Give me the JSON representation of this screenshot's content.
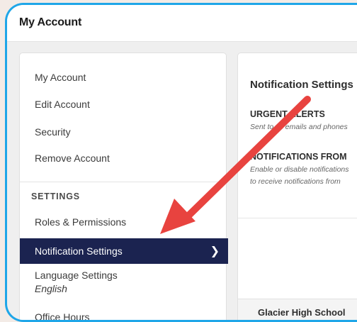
{
  "window": {
    "title": "My Account"
  },
  "sidebar": {
    "items": [
      {
        "label": "My Account"
      },
      {
        "label": "Edit Account"
      },
      {
        "label": "Security"
      },
      {
        "label": "Remove Account"
      }
    ],
    "settings_heading": "SETTINGS",
    "settings_items": [
      {
        "label": "Roles & Permissions"
      },
      {
        "label": "Notification Settings",
        "active": true
      },
      {
        "label": "Language Settings",
        "sublabel": "English"
      },
      {
        "label": "Office Hours"
      }
    ]
  },
  "content": {
    "title": "Notification Settings",
    "urgent_heading": "URGENT ALERTS",
    "urgent_sub": "Sent to all emails and phones",
    "notif_heading": "NOTIFICATIONS FROM",
    "notif_sub_1": "Enable or disable notifications",
    "notif_sub_2": "to receive notifications from",
    "school": "Glacier High School"
  },
  "colors": {
    "frame_border": "#1fa6e8",
    "active_row": "#1b2350",
    "annotation_arrow": "#e8433f"
  },
  "icons": {
    "active_chevron": "chevron-right-icon",
    "annotation": "red-arrow-annotation"
  }
}
